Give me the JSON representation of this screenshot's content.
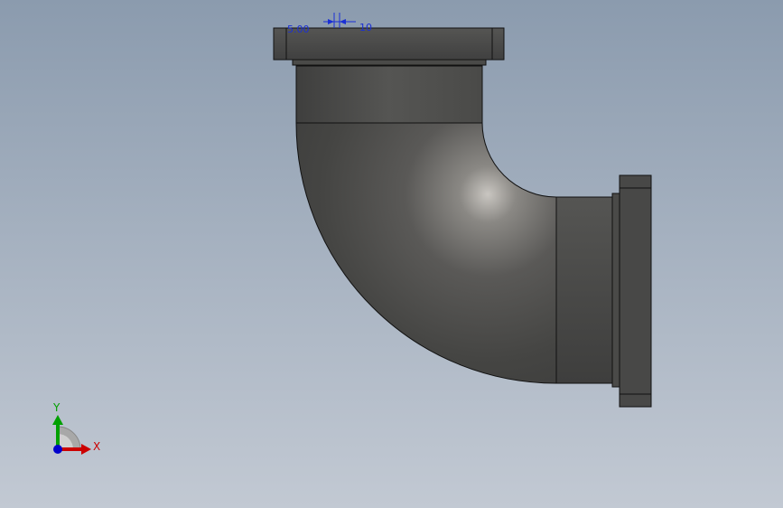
{
  "viewport": {
    "background_top": "#8b9bae",
    "background_bottom": "#c2c9d3"
  },
  "model": {
    "name_icon": "pipe-elbow-flanged",
    "body_color": "#4a4a48",
    "highlight_color": "#bdbab5",
    "edge_color": "#111111"
  },
  "dimension": {
    "value_left": "5.00",
    "value_right": "10",
    "color": "#1a2fd6"
  },
  "triad": {
    "x_label": "X",
    "y_label": "Y",
    "x_color": "#cc0000",
    "y_color": "#00a000",
    "z_color": "#0000cc"
  }
}
